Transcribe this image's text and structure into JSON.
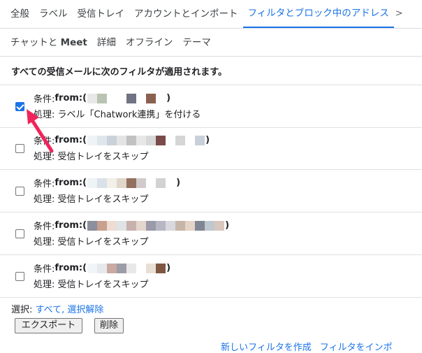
{
  "tabs_row1": [
    {
      "label": "全般"
    },
    {
      "label": "ラベル"
    },
    {
      "label": "受信トレイ"
    },
    {
      "label": "アカウントとインポート"
    },
    {
      "label": "フィルタとブロック中のアドレス",
      "active": true
    }
  ],
  "tabs_row2": [
    {
      "label": "チャットと ",
      "bold_suffix": "Meet"
    },
    {
      "label": "詳細"
    },
    {
      "label": "オフライン"
    },
    {
      "label": "テーマ"
    }
  ],
  "heading": "すべての受信メールに次のフィルタが適用されます。",
  "filters": [
    {
      "checked": true,
      "condition_label": "条件: ",
      "from_label": "from:(",
      "close": ")",
      "action": "処理: ラベル「Chatwork連携」を付ける",
      "redact_colors": [
        "#e8e8e8",
        "#b9c4b4",
        "#ffffff",
        "#ffffff",
        "#6f7383",
        "#ffffff",
        "#8a6050",
        "#ffffff"
      ]
    },
    {
      "checked": false,
      "condition_label": "条件: ",
      "from_label": "from:(",
      "close": ")",
      "action": "処理: 受信トレイをスキップ",
      "redact_colors": [
        "#eef3f6",
        "#dfe7ec",
        "#c9d2d9",
        "#e4e4e4",
        "#c2c2c2",
        "#e7e7e7",
        "#d8d8d8",
        "#7a4a4a",
        "#ffffff",
        "#d5d5d5",
        "#ffffff",
        "#c8d1d9"
      ]
    },
    {
      "checked": false,
      "condition_label": "条件: ",
      "from_label": "from:(",
      "close": ")",
      "action": "処理: 受信トレイをスキップ",
      "redact_colors": [
        "#eef3f6",
        "#d8e2e8",
        "#f3efe9",
        "#e0d6c9",
        "#94705e",
        "#d1cbcb",
        "#ffffff",
        "#d2d2d2",
        "#ffffff"
      ]
    },
    {
      "checked": false,
      "condition_label": "条件: ",
      "from_label": "from:(",
      "close": ")",
      "action": "処理: 受信トレイをスキップ",
      "redact_colors": [
        "#8c8f9c",
        "#c8a08e",
        "#ecdcd2",
        "#dfe3e6",
        "#c8b0ac",
        "#e4d6cc",
        "#9a9aa9",
        "#b7b7c4",
        "#d8d8de",
        "#c7b6a8",
        "#e4d3c7",
        "#808693",
        "#c0c8cf",
        "#d7c7bd"
      ]
    },
    {
      "checked": false,
      "condition_label": "条件: ",
      "from_label": "from:(",
      "close": ")",
      "action": "処理: 受信トレイをスキップ",
      "redact_colors": [
        "#f2f5f7",
        "#e6e9ec",
        "#c9a9a2",
        "#9d9da8",
        "#e8e8e8",
        "#ffffff",
        "#e9e0d5",
        "#7f5740"
      ]
    }
  ],
  "select": {
    "label": "選択: ",
    "all": "すべて",
    "sep": ", ",
    "none": "選択解除"
  },
  "buttons": {
    "export": "エクスポート",
    "delete": "削除"
  },
  "bottom_links": {
    "create": "新しいフィルタを作成",
    "import": "フィルタをインポ"
  },
  "colors": {
    "accent": "#1a73e8",
    "arrow": "#f0245a"
  }
}
